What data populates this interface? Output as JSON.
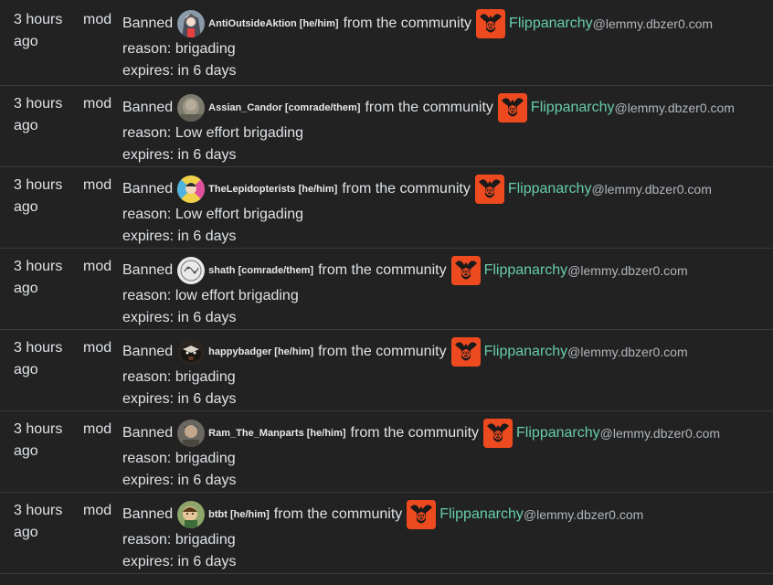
{
  "theme": {
    "background": "#222222",
    "community_color": "#66cdaa",
    "community_icon_bg": "#ee4a1f"
  },
  "entries": [
    {
      "time": "3 hours ago",
      "actor": "mod",
      "action": "Banned",
      "username": "AntiOutsideAktion [he/him]",
      "from_text": "from the community",
      "community": "Flippanarchy",
      "instance": "@lemmy.dbzer0.com",
      "reason": "reason: brigading",
      "expires": "expires: in 6 days",
      "avatar_icon": "avatar-anime-girl-icon"
    },
    {
      "time": "3 hours ago",
      "actor": "mod",
      "action": "Banned",
      "username": "Assian_Candor [comrade/them]",
      "from_text": "from the community",
      "community": "Flippanarchy",
      "instance": "@lemmy.dbzer0.com",
      "reason": "reason: Low effort brigading",
      "expires": "expires: in 6 days",
      "avatar_icon": "avatar-photo-icon"
    },
    {
      "time": "3 hours ago",
      "actor": "mod",
      "action": "Banned",
      "username": "TheLepidopterists [he/him]",
      "from_text": "from the community",
      "community": "Flippanarchy",
      "instance": "@lemmy.dbzer0.com",
      "reason": "reason: Low effort brigading",
      "expires": "expires: in 6 days",
      "avatar_icon": "avatar-colorful-icon"
    },
    {
      "time": "3 hours ago",
      "actor": "mod",
      "action": "Banned",
      "username": "shath [comrade/them]",
      "from_text": "from the community",
      "community": "Flippanarchy",
      "instance": "@lemmy.dbzer0.com",
      "reason": "reason: low effort brigading",
      "expires": "expires: in 6 days",
      "avatar_icon": "avatar-sketch-icon"
    },
    {
      "time": "3 hours ago",
      "actor": "mod",
      "action": "Banned",
      "username": "happybadger [he/him]",
      "from_text": "from the community",
      "community": "Flippanarchy",
      "instance": "@lemmy.dbzer0.com",
      "reason": "reason: brigading",
      "expires": "expires: in 6 days",
      "avatar_icon": "avatar-badger-icon"
    },
    {
      "time": "3 hours ago",
      "actor": "mod",
      "action": "Banned",
      "username": "Ram_The_Manparts [he/him]",
      "from_text": "from the community",
      "community": "Flippanarchy",
      "instance": "@lemmy.dbzer0.com",
      "reason": "reason: brigading",
      "expires": "expires: in 6 days",
      "avatar_icon": "avatar-portrait-icon"
    },
    {
      "time": "3 hours ago",
      "actor": "mod",
      "action": "Banned",
      "username": "btbt [he/him]",
      "from_text": "from the community",
      "community": "Flippanarchy",
      "instance": "@lemmy.dbzer0.com",
      "reason": "reason: brigading",
      "expires": "expires: in 6 days",
      "avatar_icon": "avatar-cartoon-icon"
    }
  ]
}
